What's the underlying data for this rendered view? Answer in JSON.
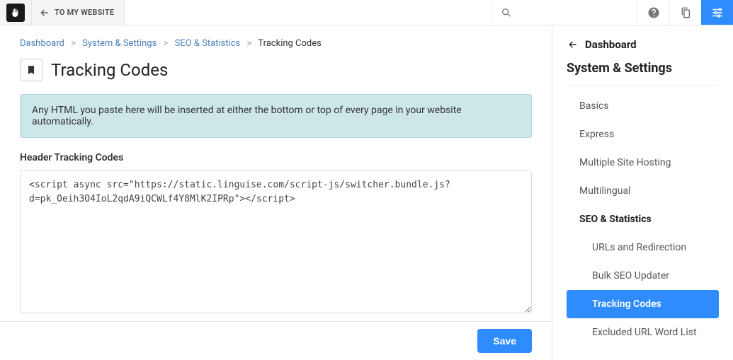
{
  "topbar": {
    "to_website": "TO MY WEBSITE"
  },
  "breadcrumb": {
    "items": [
      "Dashboard",
      "System & Settings",
      "SEO & Statistics"
    ],
    "current": "Tracking Codes"
  },
  "page": {
    "title": "Tracking Codes",
    "info": "Any HTML you paste here will be inserted at either the bottom or top of every page in your website automatically.",
    "header_label": "Header Tracking Codes",
    "header_code": "<script async src=\"https://static.linguise.com/script-js/switcher.bundle.js?d=pk_Oeih3O4IoL2qdA9iQCWLf4Y8MlK2IPRp\"></script>",
    "save": "Save"
  },
  "sidebar": {
    "back": "Dashboard",
    "heading": "System & Settings",
    "items": [
      {
        "label": "Basics"
      },
      {
        "label": "Express"
      },
      {
        "label": "Multiple Site Hosting"
      },
      {
        "label": "Multilingual"
      },
      {
        "label": "SEO & Statistics",
        "strong": true
      }
    ],
    "subitems": [
      {
        "label": "URLs and Redirection"
      },
      {
        "label": "Bulk SEO Updater"
      },
      {
        "label": "Tracking Codes",
        "active": true
      },
      {
        "label": "Excluded URL Word List"
      }
    ]
  }
}
